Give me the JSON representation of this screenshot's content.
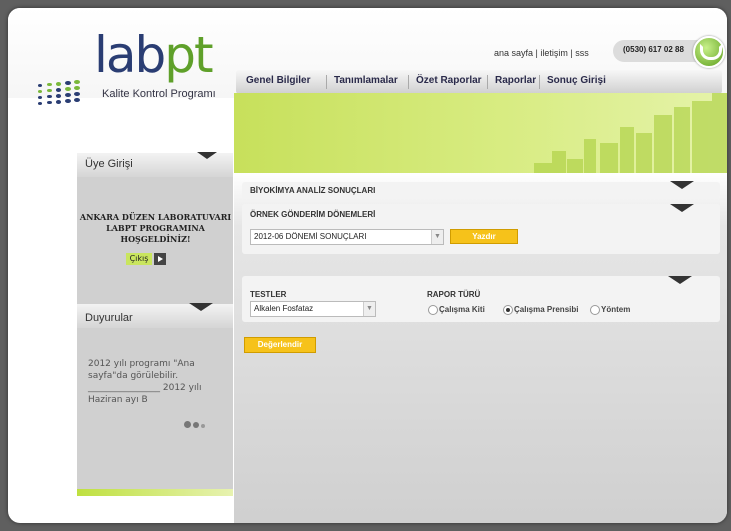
{
  "header": {
    "logo_main": "lab",
    "logo_accent": "pt",
    "tagline": "Kalite Kontrol Programı",
    "links": [
      "ana sayfa",
      "iletişim",
      "sss"
    ],
    "phone": "(0530) 617 02 88"
  },
  "nav": {
    "items": [
      "Genel Bilgiler",
      "Tanımlamalar",
      "Özet Raporlar",
      "Raporlar",
      "Sonuç Girişi"
    ]
  },
  "sidebar": {
    "login_title": "Üye Girişi",
    "welcome_text": "ANKARA DÜZEN LABORATUVARI LABPT PROGRAMINA HOŞGELDİNİZ!",
    "logout_label": "Çıkış",
    "news_title": "Duyurular",
    "news_text": "2012 yılı programı \"Ana sayfa\"da görülebilir. ________________ 2012 yılı Haziran ayı B"
  },
  "main": {
    "biochem_title": "BİYOKİMYA ANALİZ SONUÇLARI",
    "period_title": "ÖRNEK GÖNDERİM DÖNEMLERİ",
    "period_selected": "2012-06 DÖNEMİ SONUÇLARI",
    "print_label": "Yazdır",
    "tests_title": "TESTLER",
    "test_selected": "Alkalen Fosfataz",
    "report_type_title": "RAPOR TÜRÜ",
    "report_types": [
      "Çalışma Kiti",
      "Çalışma Prensibi",
      "Yöntem"
    ],
    "report_type_selected": "Çalışma Prensibi",
    "evaluate_label": "Değerlendir"
  },
  "colors": {
    "brand_blue": "#2a3d73",
    "brand_green": "#5fa02a",
    "button_yellow": "#f6c21a",
    "banner_green": "#c7e05b"
  }
}
